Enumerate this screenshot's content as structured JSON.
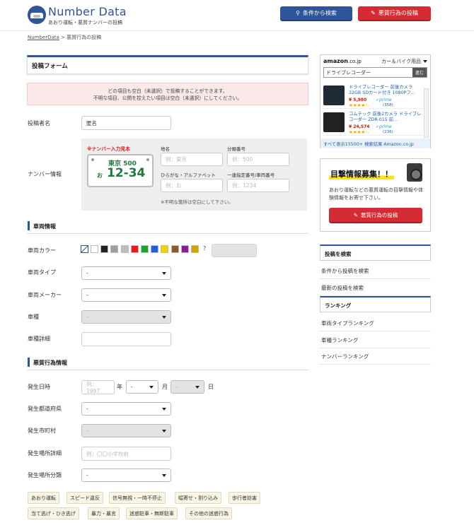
{
  "header": {
    "brand": "Number Data",
    "tagline": "あおり運転・悪質ナンバーの投稿",
    "search_btn": "条件から検索",
    "post_btn": "悪質行為の投稿"
  },
  "breadcrumb": {
    "home": "NumberData",
    "sep": " > ",
    "current": "悪質行為の投稿"
  },
  "form": {
    "title": "投稿フォーム",
    "notice_line1": "どの項目も空白（未選択）で投稿することができます。",
    "notice_line2": "不明な項目、公開を控えたい項目は空白（未選択）にしてください。",
    "poster_label": "投稿者名",
    "poster_value": "匿名",
    "plate_label": "ナンバー情報",
    "plate_sample_title": "※ナンバー入力見本",
    "plate_region": "東京 500",
    "plate_kana": "お",
    "plate_number": "12-34",
    "region_label": "地名",
    "region_ph": "例：東京",
    "class_label": "分類番号",
    "class_ph": "例：500",
    "kana_label": "ひらがな・アルファベット",
    "kana_ph": "例：お",
    "serial_label": "一連指定番号/車両番号",
    "serial_ph": "例：1234",
    "plate_note": "※不明な箇所は空白にして下さい。"
  },
  "vehicle": {
    "section": "車両情報",
    "color_label": "車両カラー",
    "color_unknown": "?",
    "colors": [
      "#ffffff",
      "#222222",
      "#9e9e9e",
      "#bdbdbd",
      "#e31b1b",
      "#1fa12f",
      "#1f5fd6",
      "#f2d200",
      "#8a5a2b",
      "#8e1b9a",
      "#d4a200"
    ],
    "type_label": "車両タイプ",
    "type_value": "-",
    "maker_label": "車両メーカー",
    "maker_value": "-",
    "model_label": "車種",
    "model_value": "-",
    "detail_label": "車種詳細"
  },
  "incident": {
    "section": "悪質行為情報",
    "date_label": "発生日時",
    "year_ph": "例：1997",
    "year_unit": "年",
    "month_value": "-",
    "month_unit": "月",
    "day_value": "-",
    "day_unit": "日",
    "pref_label": "発生都道府県",
    "pref_value": "-",
    "city_label": "発生市町村",
    "city_value": "-",
    "place_label": "発生場所詳細",
    "place_ph": "例：〇〇小学校前",
    "place_type_label": "発生場所分類",
    "place_type_value": "-",
    "tags": [
      "あおり運転",
      "スピード違反",
      "信号無視・一時不停止",
      "幅寄せ・割り込み",
      "歩行者妨害",
      "当て逃げ・ひき逃げ",
      "暴力・暴言",
      "迷惑駐車・無断駐車",
      "その他の迷惑行為"
    ]
  },
  "amazon": {
    "logo": "amazon",
    "logo_tld": ".co.jp",
    "category": "カー＆バイク用品",
    "query": "ドライブレコーダー",
    "go": "進む",
    "items": [
      {
        "title": "ドライブレコーダー 前後カメラ 32GB SDカード付き 1080Pフ...",
        "price": "¥ 5,980",
        "prime": "✓prime",
        "stars": "★★★★☆",
        "reviews": "(358)"
      },
      {
        "title": "コムテック 前後2カメラ ドライブレコーダー ZDR-015 前...",
        "price": "¥ 24,574",
        "prime": "✓prime",
        "stars": "★★★★☆",
        "reviews": "(236)"
      }
    ],
    "footer": "すべて表示15500+ 検索結果 Amazon.co.jp"
  },
  "recruit": {
    "title": "目撃情報募集！！",
    "desc": "あおり運転などの悪質運転の目撃情報や体験情報をお寄せ下さい。",
    "button": "悪質行為の投稿"
  },
  "sidebar": {
    "search_head": "投稿を検索",
    "search_links": [
      "条件から投稿を検索",
      "最新の投稿を検索"
    ],
    "rank_head": "ランキング",
    "rank_links": [
      "車両タイプランキング",
      "車種ランキング",
      "ナンバーランキング"
    ]
  }
}
